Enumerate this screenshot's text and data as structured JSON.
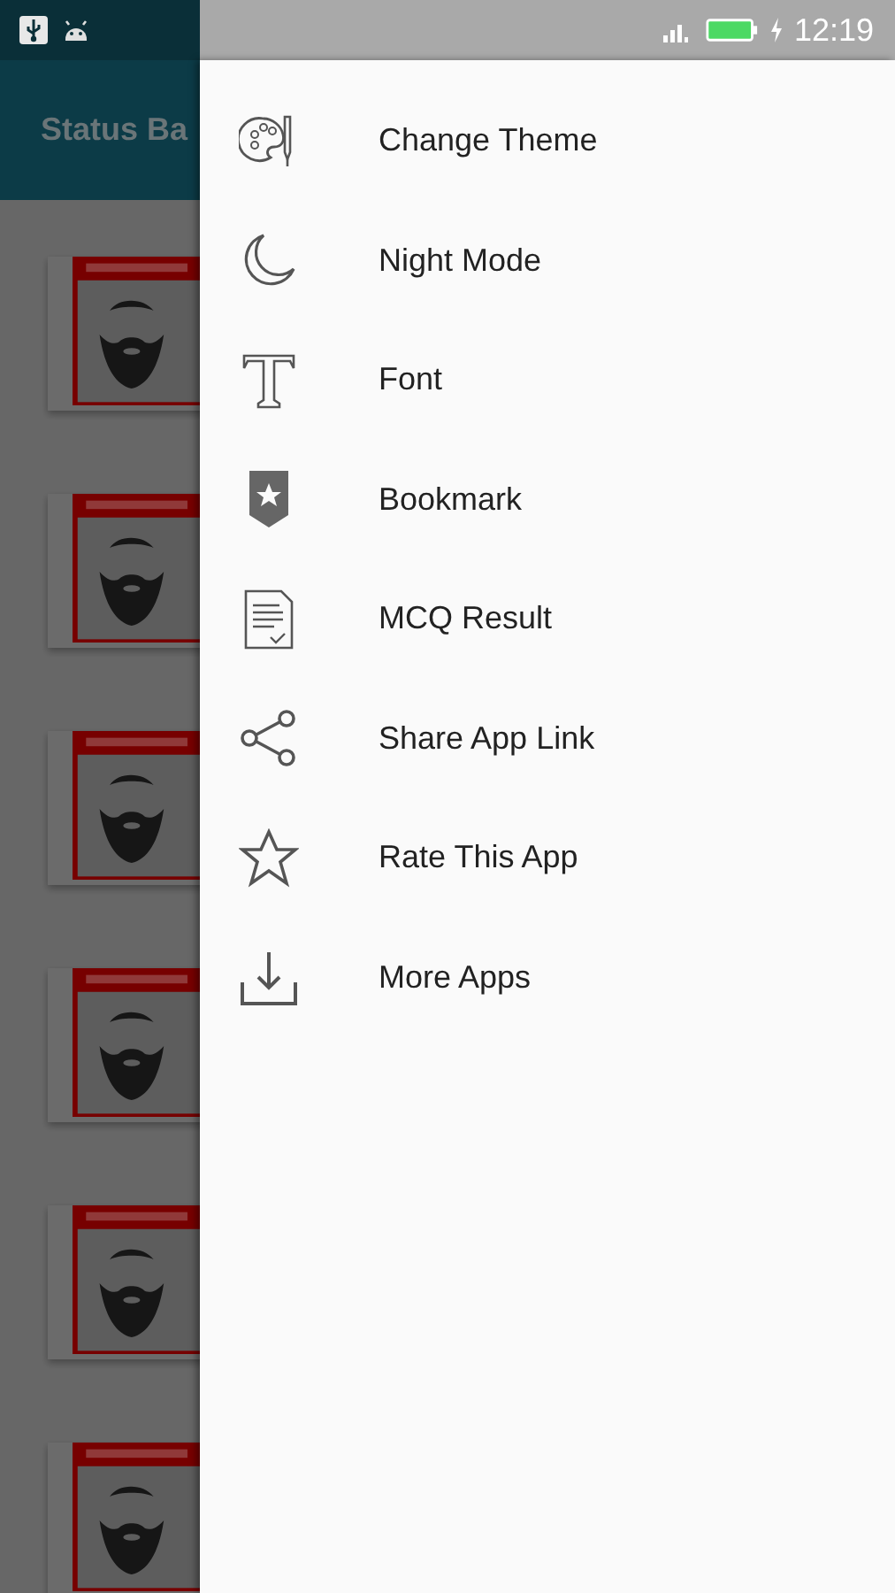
{
  "status_bar": {
    "time": "12:19"
  },
  "app_bar": {
    "title": "Status Ba"
  },
  "drawer": {
    "items": [
      {
        "kind": "palette",
        "label": "Change Theme"
      },
      {
        "kind": "moon",
        "label": "Night Mode"
      },
      {
        "kind": "font",
        "label": "Font"
      },
      {
        "kind": "bookmark",
        "label": "Bookmark"
      },
      {
        "kind": "document",
        "label": "MCQ Result"
      },
      {
        "kind": "share",
        "label": "Share App Link"
      },
      {
        "kind": "star",
        "label": "Rate This App"
      },
      {
        "kind": "download",
        "label": "More Apps"
      }
    ]
  }
}
